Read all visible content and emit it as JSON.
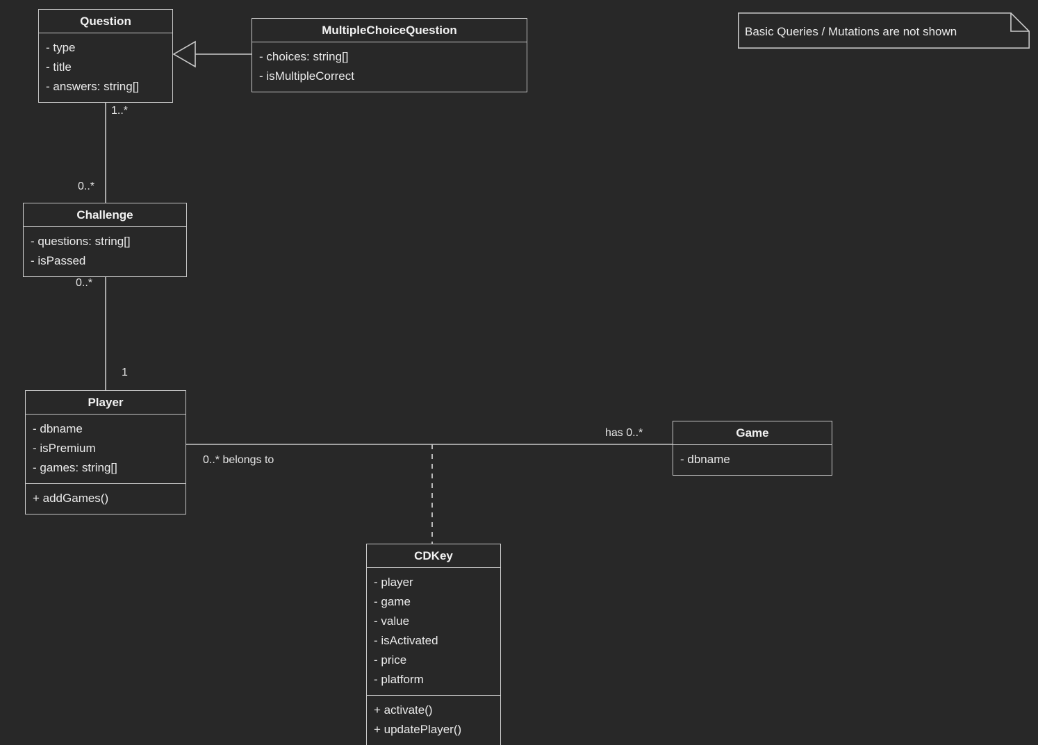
{
  "diagram": {
    "kind": "uml-class-diagram",
    "background_color": "#282828",
    "line_color": "#c9c9c9",
    "text_color": "#eaeaea"
  },
  "classes": {
    "question": {
      "name": "Question",
      "attributes": [
        "- type",
        "- title",
        "- answers: string[]"
      ],
      "methods": []
    },
    "multiple_choice_question": {
      "name": "MultipleChoiceQuestion",
      "attributes": [
        "- choices: string[]",
        "- isMultipleCorrect"
      ],
      "methods": []
    },
    "challenge": {
      "name": "Challenge",
      "attributes": [
        "- questions: string[]",
        "- isPassed"
      ],
      "methods": []
    },
    "player": {
      "name": "Player",
      "attributes": [
        "- dbname",
        "- isPremium",
        "- games: string[]"
      ],
      "methods": [
        "+ addGames()"
      ]
    },
    "game": {
      "name": "Game",
      "attributes": [
        "- dbname"
      ],
      "methods": []
    },
    "cdkey": {
      "name": "CDKey",
      "attributes": [
        "- player",
        "- game",
        "- value",
        "- isActivated",
        "- price",
        "- platform"
      ],
      "methods": [
        "+ activate()",
        "+ updatePlayer()"
      ]
    }
  },
  "note": {
    "text": "Basic Queries / Mutations are not shown"
  },
  "edge_labels": {
    "question_to_challenge_near_question": "1..*",
    "question_to_challenge_near_challenge": "0..*",
    "challenge_to_player_near_challenge": "0..*",
    "challenge_to_player_near_player": "1",
    "player_to_game_near_player": "0..* belongs to",
    "player_to_game_near_game": "has 0..*"
  }
}
